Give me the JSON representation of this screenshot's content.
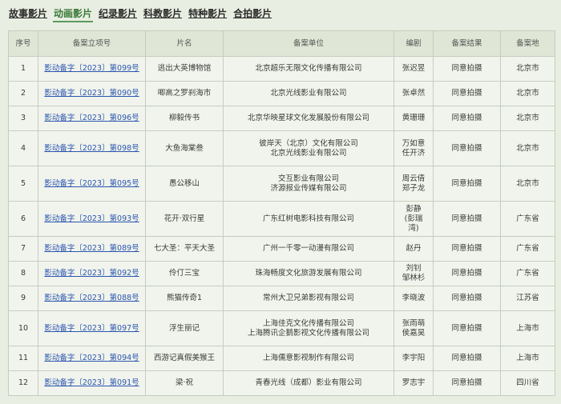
{
  "tabs": [
    {
      "label": "故事影片",
      "active": false
    },
    {
      "label": "动画影片",
      "active": true
    },
    {
      "label": "纪录影片",
      "active": false
    },
    {
      "label": "科教影片",
      "active": false
    },
    {
      "label": "特种影片",
      "active": false
    },
    {
      "label": "合拍影片",
      "active": false
    }
  ],
  "table": {
    "headers": [
      "序号",
      "备案立项号",
      "片名",
      "备案单位",
      "编剧",
      "备案结果",
      "备案地"
    ],
    "rows": [
      {
        "no": "1",
        "id": "影动备字〔2023〕第099号",
        "title": "逃出大英博物馆",
        "units": [
          "北京超乐无限文化传播有限公司"
        ],
        "writers": [
          "张迟昱"
        ],
        "result": "同意拍摄",
        "place": "北京市"
      },
      {
        "no": "2",
        "id": "影动备字〔2023〕第090号",
        "title": "唧高之罗刹海市",
        "units": [
          "北京光线影业有限公司"
        ],
        "writers": [
          "张卓然"
        ],
        "result": "同意拍摄",
        "place": "北京市"
      },
      {
        "no": "3",
        "id": "影动备字〔2023〕第096号",
        "title": "柳毅传书",
        "units": [
          "北京华映星球文化发展股份有限公司"
        ],
        "writers": [
          "黄珊珊"
        ],
        "result": "同意拍摄",
        "place": "北京市"
      },
      {
        "no": "4",
        "id": "影动备字〔2023〕第098号",
        "title": "大鱼海棠叁",
        "units": [
          "彼岸天（北京）文化有限公司",
          "北京光线影业有限公司"
        ],
        "writers": [
          "万如意",
          "任开济"
        ],
        "result": "同意拍摄",
        "place": "北京市"
      },
      {
        "no": "5",
        "id": "影动备字〔2023〕第095号",
        "title": "愚公移山",
        "units": [
          "交互影业有限公司",
          "济源报业传媒有限公司"
        ],
        "writers": [
          "周云倩",
          "郑子龙"
        ],
        "result": "同意拍摄",
        "place": "北京市"
      },
      {
        "no": "6",
        "id": "影动备字〔2023〕第093号",
        "title": "花开·双行星",
        "units": [
          "广东红树电影科技有限公司"
        ],
        "writers": [
          "彭静",
          "(彭瑞",
          "湾)"
        ],
        "result": "同意拍摄",
        "place": "广东省"
      },
      {
        "no": "7",
        "id": "影动备字〔2023〕第089号",
        "title": "七大圣：平天大圣",
        "units": [
          "广州一千零一动漫有限公司"
        ],
        "writers": [
          "赵丹"
        ],
        "result": "同意拍摄",
        "place": "广东省"
      },
      {
        "no": "8",
        "id": "影动备字〔2023〕第092号",
        "title": "伶仃三宝",
        "units": [
          "珠海畅度文化旅游发展有限公司"
        ],
        "writers": [
          "刘钊",
          "邹林杉"
        ],
        "result": "同意拍摄",
        "place": "广东省"
      },
      {
        "no": "9",
        "id": "影动备字〔2023〕第088号",
        "title": "熊猫传奇1",
        "units": [
          "常州大卫兄弟影视有限公司"
        ],
        "writers": [
          "李晓波"
        ],
        "result": "同意拍摄",
        "place": "江苏省"
      },
      {
        "no": "10",
        "id": "影动备字〔2023〕第097号",
        "title": "浮生丽记",
        "units": [
          "上海佳克文化传播有限公司",
          "上海腾讯企鹅影视文化传播有限公司"
        ],
        "writers": [
          "张雨萌",
          "侯嘉昊"
        ],
        "result": "同意拍摄",
        "place": "上海市"
      },
      {
        "no": "11",
        "id": "影动备字〔2023〕第094号",
        "title": "西游记真假美猴王",
        "units": [
          "上海儒意影视制作有限公司"
        ],
        "writers": [
          "李宇阳"
        ],
        "result": "同意拍摄",
        "place": "上海市"
      },
      {
        "no": "12",
        "id": "影动备字〔2023〕第091号",
        "title": "梁·祝",
        "units": [
          "青春光线（成都）影业有限公司"
        ],
        "writers": [
          "罗志宇"
        ],
        "result": "同意拍摄",
        "place": "四川省"
      }
    ]
  }
}
